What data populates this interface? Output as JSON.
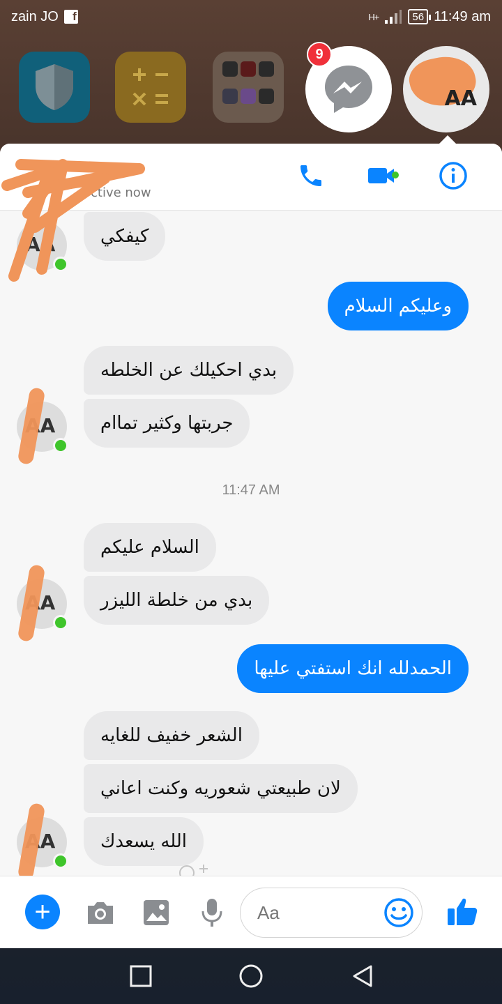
{
  "status_bar": {
    "carrier": "zain JO",
    "fb_glyph": "f",
    "network_type": "H+",
    "battery": "56",
    "time": "11:49 am"
  },
  "home_row": {
    "apps": [
      {
        "name": "shield-app",
        "icon": "shield-icon"
      },
      {
        "name": "calculator-app",
        "icon": "calculator-icon"
      },
      {
        "name": "games-folder",
        "icon": "folder-icon"
      }
    ],
    "messenger_badge": "9"
  },
  "chat_header": {
    "active_status": "ctive now",
    "icons": [
      "phone-icon",
      "video-camera-icon",
      "info-icon"
    ]
  },
  "messages": [
    {
      "sender": "them",
      "text": "كيفكي"
    },
    {
      "sender": "me",
      "text": "وعليكم السلام"
    },
    {
      "sender": "them",
      "text": "بدي احكيلك عن الخلطه"
    },
    {
      "sender": "them",
      "text": "جربتها وكثير تماام"
    },
    {
      "sender": "them",
      "text": "السلام عليكم"
    },
    {
      "sender": "them",
      "text": "بدي من خلطة الليزر"
    },
    {
      "sender": "me",
      "text": "الحمدلله انك استفتي عليها"
    },
    {
      "sender": "them",
      "text": "الشعر خفيف للغايه"
    },
    {
      "sender": "them",
      "text": "لان طبيعتي شعوريه وكنت اعاني"
    },
    {
      "sender": "them",
      "text": "الله يسعدك"
    }
  ],
  "timestamp": "11:47 AM",
  "avatar_initials": "AA",
  "composer": {
    "placeholder": "Aa",
    "icons": [
      "plus-icon",
      "camera-icon",
      "image-icon",
      "microphone-icon",
      "emoji-icon",
      "thumbs-up-icon"
    ],
    "plus_glyph": "+"
  },
  "colors": {
    "accent": "#0a84ff",
    "online": "#3fc52b",
    "badge": "#f0303a",
    "incoming_bubble": "#e9e9ea"
  }
}
